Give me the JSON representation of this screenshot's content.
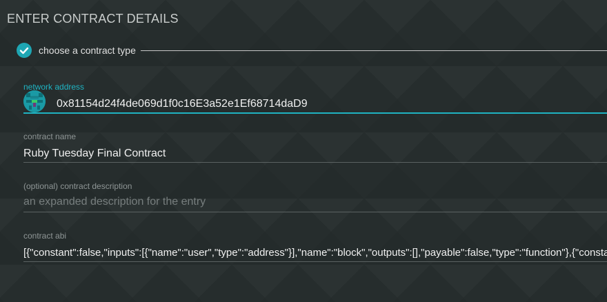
{
  "title": "ENTER CONTRACT DETAILS",
  "step": {
    "label": "choose a contract type",
    "icon": "check-circle-icon"
  },
  "fields": {
    "address": {
      "label": "network address",
      "value": "0x81154d24f4de069d1f0c16E3a52e1Ef68714daD9",
      "icon": "identicon-avatar"
    },
    "name": {
      "label": "contract name",
      "value": "Ruby Tuesday Final Contract"
    },
    "description": {
      "label": "(optional) contract description",
      "placeholder": "an expanded description for the entry"
    },
    "abi": {
      "label": "contract abi",
      "value": "[{\"constant\":false,\"inputs\":[{\"name\":\"user\",\"type\":\"address\"}],\"name\":\"block\",\"outputs\":[],\"payable\":false,\"type\":\"function\"},{\"constant\":false,"
    }
  },
  "colors": {
    "accent": "#1fb3c2",
    "background": "#262d2d"
  }
}
